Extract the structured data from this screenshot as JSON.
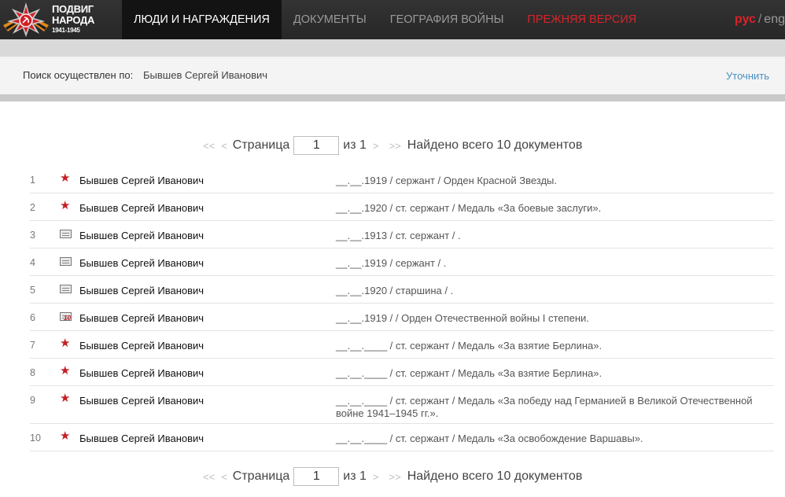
{
  "header": {
    "logo": {
      "line1": "ПОДВИГ",
      "line2": "НАРОДА",
      "years": "1941-1945"
    },
    "nav": [
      {
        "label": "ЛЮДИ И НАГРАЖДЕНИЯ",
        "active": true
      },
      {
        "label": "ДОКУМЕНТЫ"
      },
      {
        "label": "ГЕОГРАФИЯ ВОЙНЫ"
      },
      {
        "label": "ПРЕЖНЯЯ ВЕРСИЯ"
      }
    ],
    "lang": {
      "ru": "рус",
      "separator": "/",
      "en": "eng"
    },
    "accent_color": "#d8232a"
  },
  "search": {
    "label": "Поиск осуществлен по:",
    "query": "Бывшев Сергей Иванович",
    "refine": "Уточнить"
  },
  "pager": {
    "first": "<<",
    "prev": "<",
    "page_label": "Страница",
    "page_value": "1",
    "of_label": "из 1",
    "next": ">",
    "last": ">>",
    "found_text": "Найдено всего 10 документов"
  },
  "results": [
    {
      "num": "1",
      "icon": "star-icon",
      "name": "Бывшев Сергей Иванович",
      "details": "__.__.1919 /  сержант /  Орден Красной Звезды."
    },
    {
      "num": "2",
      "icon": "star-icon",
      "name": "Бывшев Сергей Иванович",
      "details": "__.__.1920 /  ст. сержант /  Медаль «За боевые заслуги»."
    },
    {
      "num": "3",
      "icon": "document-icon",
      "name": "Бывшев Сергей Иванович",
      "details": "__.__.1913 /  ст. сержант /  ."
    },
    {
      "num": "4",
      "icon": "document-icon",
      "name": "Бывшев Сергей Иванович",
      "details": "__.__.1919 /  сержант /  ."
    },
    {
      "num": "5",
      "icon": "document-icon",
      "name": "Бывшев Сергей Иванович",
      "details": "__.__.1920 /  старшина /  ."
    },
    {
      "num": "6",
      "icon": "document-badge-icon",
      "badge": "10",
      "name": "Бывшев Сергей Иванович",
      "details": "__.__.1919 /   /  Орден Отечественной войны I степени."
    },
    {
      "num": "7",
      "icon": "star-icon",
      "name": "Бывшев Сергей Иванович",
      "details": "__.__.____ /  ст. сержант /  Медаль «За взятие Берлина»."
    },
    {
      "num": "8",
      "icon": "star-icon",
      "name": "Бывшев Сергей Иванович",
      "details": "__.__.____ /  ст. сержант /  Медаль «За взятие Берлина»."
    },
    {
      "num": "9",
      "icon": "star-icon",
      "name": "Бывшев Сергей Иванович",
      "details": "__.__.____ /  ст. сержант /  Медаль «За победу над Германией в Великой Отечественной войне 1941–1945 гг.»."
    },
    {
      "num": "10",
      "icon": "star-icon",
      "name": "Бывшев Сергей Иванович",
      "details": "__.__.____ /  ст. сержант /  Медаль «За освобождение Варшавы»."
    }
  ]
}
